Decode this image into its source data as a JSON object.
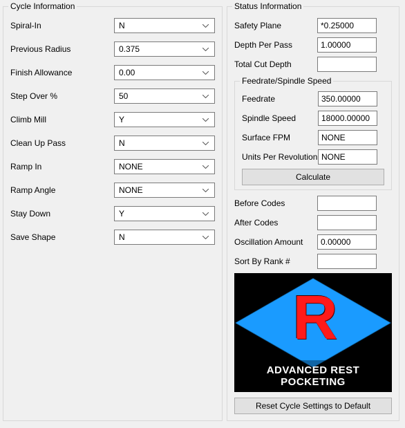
{
  "cycle": {
    "legend": "Cycle Information",
    "rows": [
      {
        "label": "Spiral-In",
        "value": "N"
      },
      {
        "label": "Previous Radius",
        "value": "0.375"
      },
      {
        "label": "Finish Allowance",
        "value": "0.00"
      },
      {
        "label": "Step Over %",
        "value": "50"
      },
      {
        "label": "Climb Mill",
        "value": "Y"
      },
      {
        "label": "Clean Up Pass",
        "value": "N"
      },
      {
        "label": "Ramp In",
        "value": "NONE"
      },
      {
        "label": "Ramp Angle",
        "value": "NONE"
      },
      {
        "label": "Stay Down",
        "value": "Y"
      },
      {
        "label": "Save Shape",
        "value": "N"
      }
    ]
  },
  "status": {
    "legend": "Status Information",
    "safety_plane_label": "Safety Plane",
    "safety_plane_value": "*0.25000",
    "depth_per_pass_label": "Depth Per Pass",
    "depth_per_pass_value": "1.00000",
    "total_cut_depth_label": "Total Cut Depth",
    "total_cut_depth_value": "",
    "feed": {
      "legend": "Feedrate/Spindle Speed",
      "feedrate_label": "Feedrate",
      "feedrate_value": "350.00000",
      "spindle_label": "Spindle Speed",
      "spindle_value": "18000.00000",
      "surface_label": "Surface FPM",
      "surface_value": "NONE",
      "upr_label": "Units Per Revolution",
      "upr_value": "NONE",
      "calculate": "Calculate"
    },
    "before_label": "Before Codes",
    "before_value": "",
    "after_label": "After Codes",
    "after_value": "",
    "osc_label": "Oscillation Amount",
    "osc_value": "0.00000",
    "sort_label": "Sort By Rank #",
    "sort_value": "",
    "image_caption": "ADVANCED REST POCKETING",
    "reset": "Reset Cycle Settings to Default"
  }
}
